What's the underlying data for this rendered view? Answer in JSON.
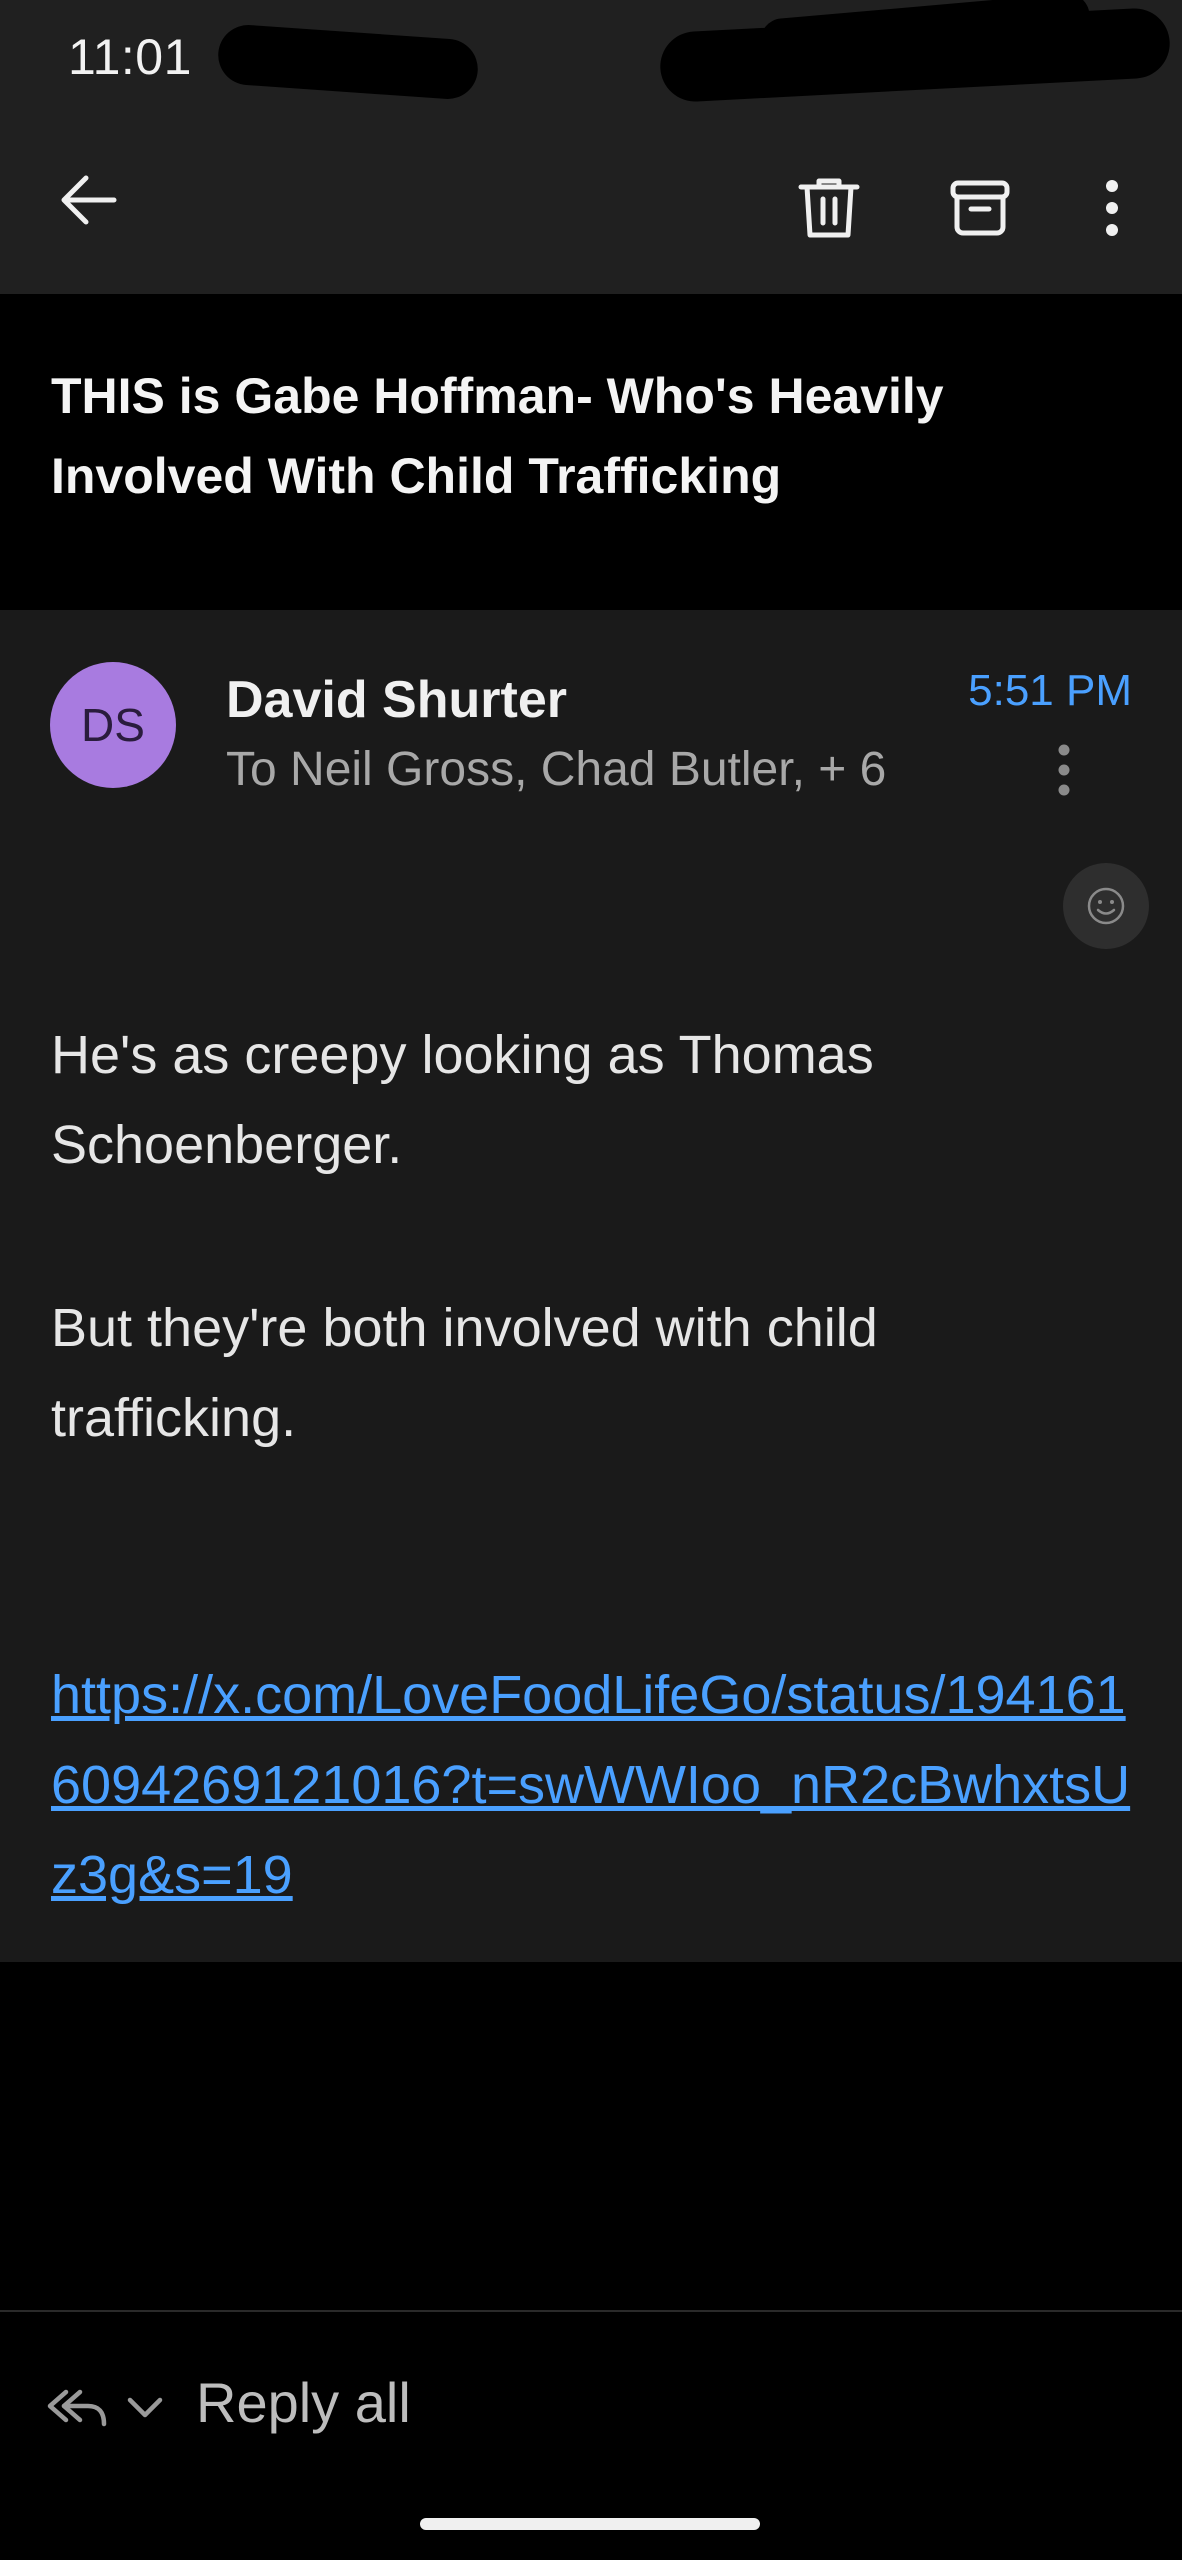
{
  "status_bar": {
    "time": "11:01"
  },
  "toolbar": {
    "back_icon": "arrow-left-icon",
    "delete_icon": "trash-icon",
    "archive_icon": "archive-icon",
    "more_icon": "more-vertical-icon"
  },
  "email": {
    "subject": "THIS is Gabe Hoffman- Who's Heavily Involved With Child Trafficking",
    "sender": {
      "initials": "DS",
      "name": "David Shurter",
      "avatar_color": "#a87be0"
    },
    "recipients": "To Neil Gross, Chad Butler, + 6",
    "time": "5:51 PM",
    "body": {
      "paragraph_1": "He's as creepy looking as Thomas Schoenberger.",
      "paragraph_2": "But they're both involved with child trafficking.",
      "link": "https://x.com/LoveFoodLifeGo/status/1941616094269121016?t=swWWIoo_nR2cBwhxtsUz3g&s=19"
    }
  },
  "reply_bar": {
    "label": "Reply all"
  },
  "colors": {
    "accent": "#4aa0ff",
    "background": "#000000",
    "card": "#1a1a1a",
    "toolbar": "#202020"
  }
}
